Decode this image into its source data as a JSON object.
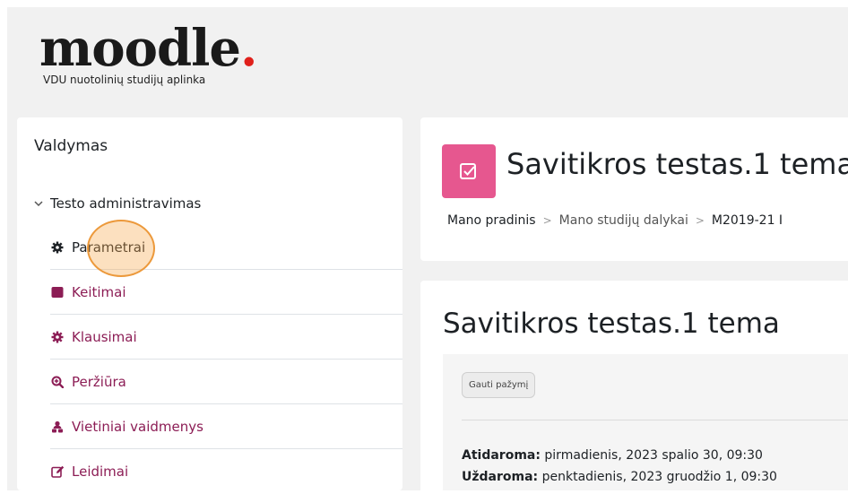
{
  "logo": {
    "word": "moodle",
    "dot": ".",
    "subtitle": "VDU nuotolinių studijų aplinka"
  },
  "sidebar": {
    "title": "Valdymas",
    "section_label": "Testo administravimas",
    "items": [
      {
        "label": "Parametrai",
        "icon": "gear-icon"
      },
      {
        "label": "Keitimai",
        "icon": "square-icon"
      },
      {
        "label": "Klausimai",
        "icon": "gear-icon"
      },
      {
        "label": "Peržiūra",
        "icon": "search-plus-icon"
      },
      {
        "label": "Vietiniai vaidmenys",
        "icon": "users-icon"
      },
      {
        "label": "Leidimai",
        "icon": "edit-icon"
      }
    ]
  },
  "header": {
    "title": "Savitikros testas.1 tema",
    "breadcrumb": [
      "Mano pradinis",
      "Mano studijų dalykai",
      "M2019-21 I"
    ]
  },
  "main": {
    "title": "Savitikros testas.1 tema",
    "completion_badge": "Gauti pažymį",
    "opened_label": "Atidaroma:",
    "opened_value": " pirmadienis, 2023 spalio 30, 09:30",
    "closed_label": "Uždaroma:",
    "closed_value": " penktadienis, 2023 gruodžio 1, 09:30"
  },
  "colors": {
    "accent": "#8c1d55",
    "quiz_icon_bg": "#e6578f",
    "logo_dot": "#e0201b",
    "click_marker": "#eb922d"
  }
}
